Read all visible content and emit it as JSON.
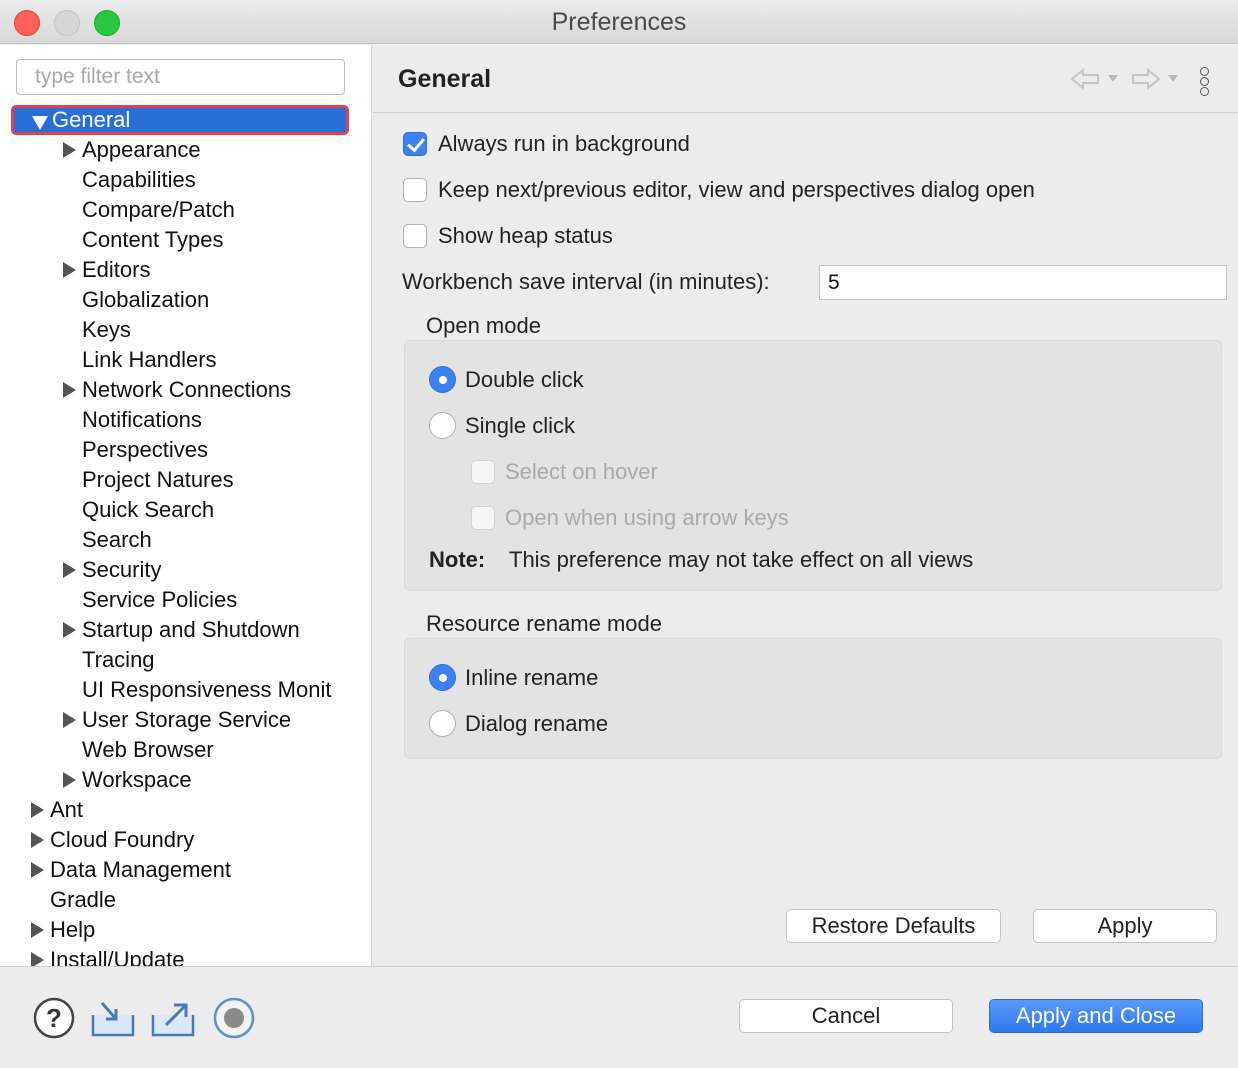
{
  "window": {
    "title": "Preferences"
  },
  "sidebar": {
    "filter_placeholder": "type filter text",
    "selected": "General",
    "children": [
      {
        "label": "Appearance",
        "expandable": true
      },
      {
        "label": "Capabilities",
        "expandable": false
      },
      {
        "label": "Compare/Patch",
        "expandable": false
      },
      {
        "label": "Content Types",
        "expandable": false
      },
      {
        "label": "Editors",
        "expandable": true
      },
      {
        "label": "Globalization",
        "expandable": false
      },
      {
        "label": "Keys",
        "expandable": false
      },
      {
        "label": "Link Handlers",
        "expandable": false
      },
      {
        "label": "Network Connections",
        "expandable": true
      },
      {
        "label": "Notifications",
        "expandable": false
      },
      {
        "label": "Perspectives",
        "expandable": false
      },
      {
        "label": "Project Natures",
        "expandable": false
      },
      {
        "label": "Quick Search",
        "expandable": false
      },
      {
        "label": "Search",
        "expandable": false
      },
      {
        "label": "Security",
        "expandable": true
      },
      {
        "label": "Service Policies",
        "expandable": false
      },
      {
        "label": "Startup and Shutdown",
        "expandable": true
      },
      {
        "label": "Tracing",
        "expandable": false
      },
      {
        "label": "UI Responsiveness Monit",
        "expandable": false
      },
      {
        "label": "User Storage Service",
        "expandable": true
      },
      {
        "label": "Web Browser",
        "expandable": false
      },
      {
        "label": "Workspace",
        "expandable": true
      }
    ],
    "top_level": [
      {
        "label": "Ant",
        "expandable": true
      },
      {
        "label": "Cloud Foundry",
        "expandable": true
      },
      {
        "label": "Data Management",
        "expandable": true
      },
      {
        "label": "Gradle",
        "expandable": false
      },
      {
        "label": "Help",
        "expandable": true
      },
      {
        "label": "Install/Update",
        "expandable": true
      }
    ]
  },
  "page": {
    "title": "General",
    "always_run_bg": {
      "label": "Always run in background",
      "checked": true
    },
    "keep_dialog_open": {
      "label": "Keep next/previous editor, view and perspectives dialog open",
      "checked": false
    },
    "show_heap": {
      "label": "Show heap status",
      "checked": false
    },
    "save_interval": {
      "label": "Workbench save interval (in minutes):",
      "value": "5"
    },
    "open_mode": {
      "label": "Open mode",
      "double_click": "Double click",
      "single_click": "Single click",
      "select_on_hover": "Select on hover",
      "open_arrow_keys": "Open when using arrow keys",
      "note_label": "Note:",
      "note_text": "This preference may not take effect on all views",
      "selected": "Double click"
    },
    "rename_mode": {
      "label": "Resource rename mode",
      "inline": "Inline rename",
      "dialog": "Dialog rename",
      "selected": "Inline rename"
    },
    "restore_defaults": "Restore Defaults",
    "apply": "Apply"
  },
  "footer": {
    "cancel": "Cancel",
    "apply_close": "Apply and Close",
    "icons": [
      "help-icon",
      "import-icon",
      "export-icon",
      "record-icon"
    ]
  },
  "colors": {
    "accent": "#3b82f0",
    "selection": "#2a6ed8",
    "highlight_border": "#e0424b"
  }
}
